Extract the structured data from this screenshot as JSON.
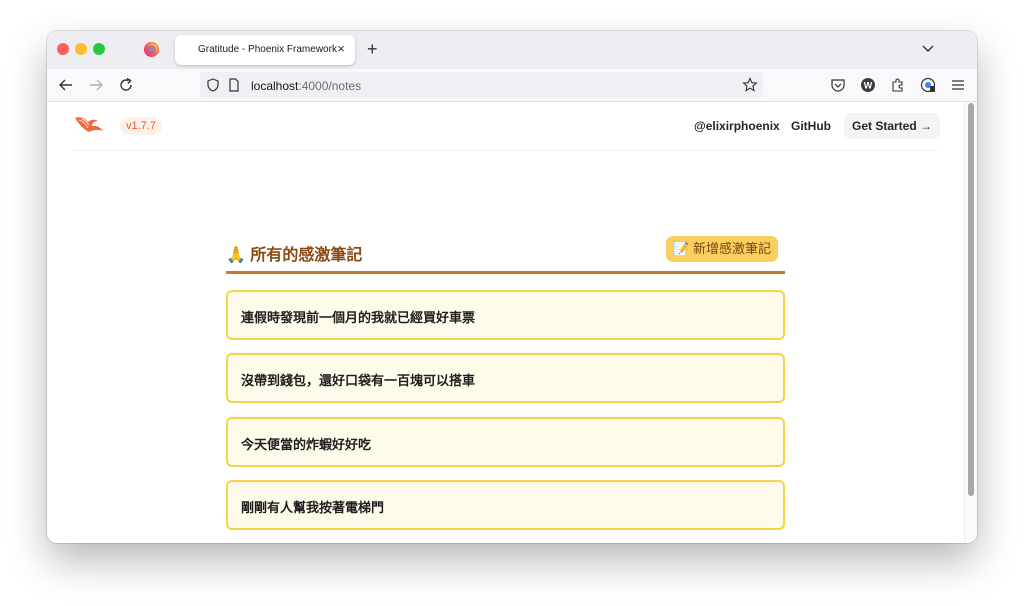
{
  "browser": {
    "tab_title": "Gratitude - Phoenix Framework",
    "tab_close": "×",
    "new_tab": "+",
    "url_host": "localhost",
    "url_rest": ":4000/notes"
  },
  "header": {
    "version": "v1.7.7",
    "handle": "@elixirphoenix",
    "github": "GitHub",
    "get_started": "Get Started →",
    "brand_color": "#ea5b21"
  },
  "notes": {
    "title": "🙏 所有的感激筆記",
    "add_button": "📝 新增感激筆記",
    "items": [
      "連假時發現前一個月的我就已經買好車票",
      "沒帶到錢包，還好口袋有一百塊可以搭車",
      "今天便當的炸蝦好好吃",
      "剛剛有人幫我按著電梯門"
    ],
    "accent_color": "#c77b2e",
    "card_border": "#f6d34a",
    "card_bg": "#fefbea"
  }
}
